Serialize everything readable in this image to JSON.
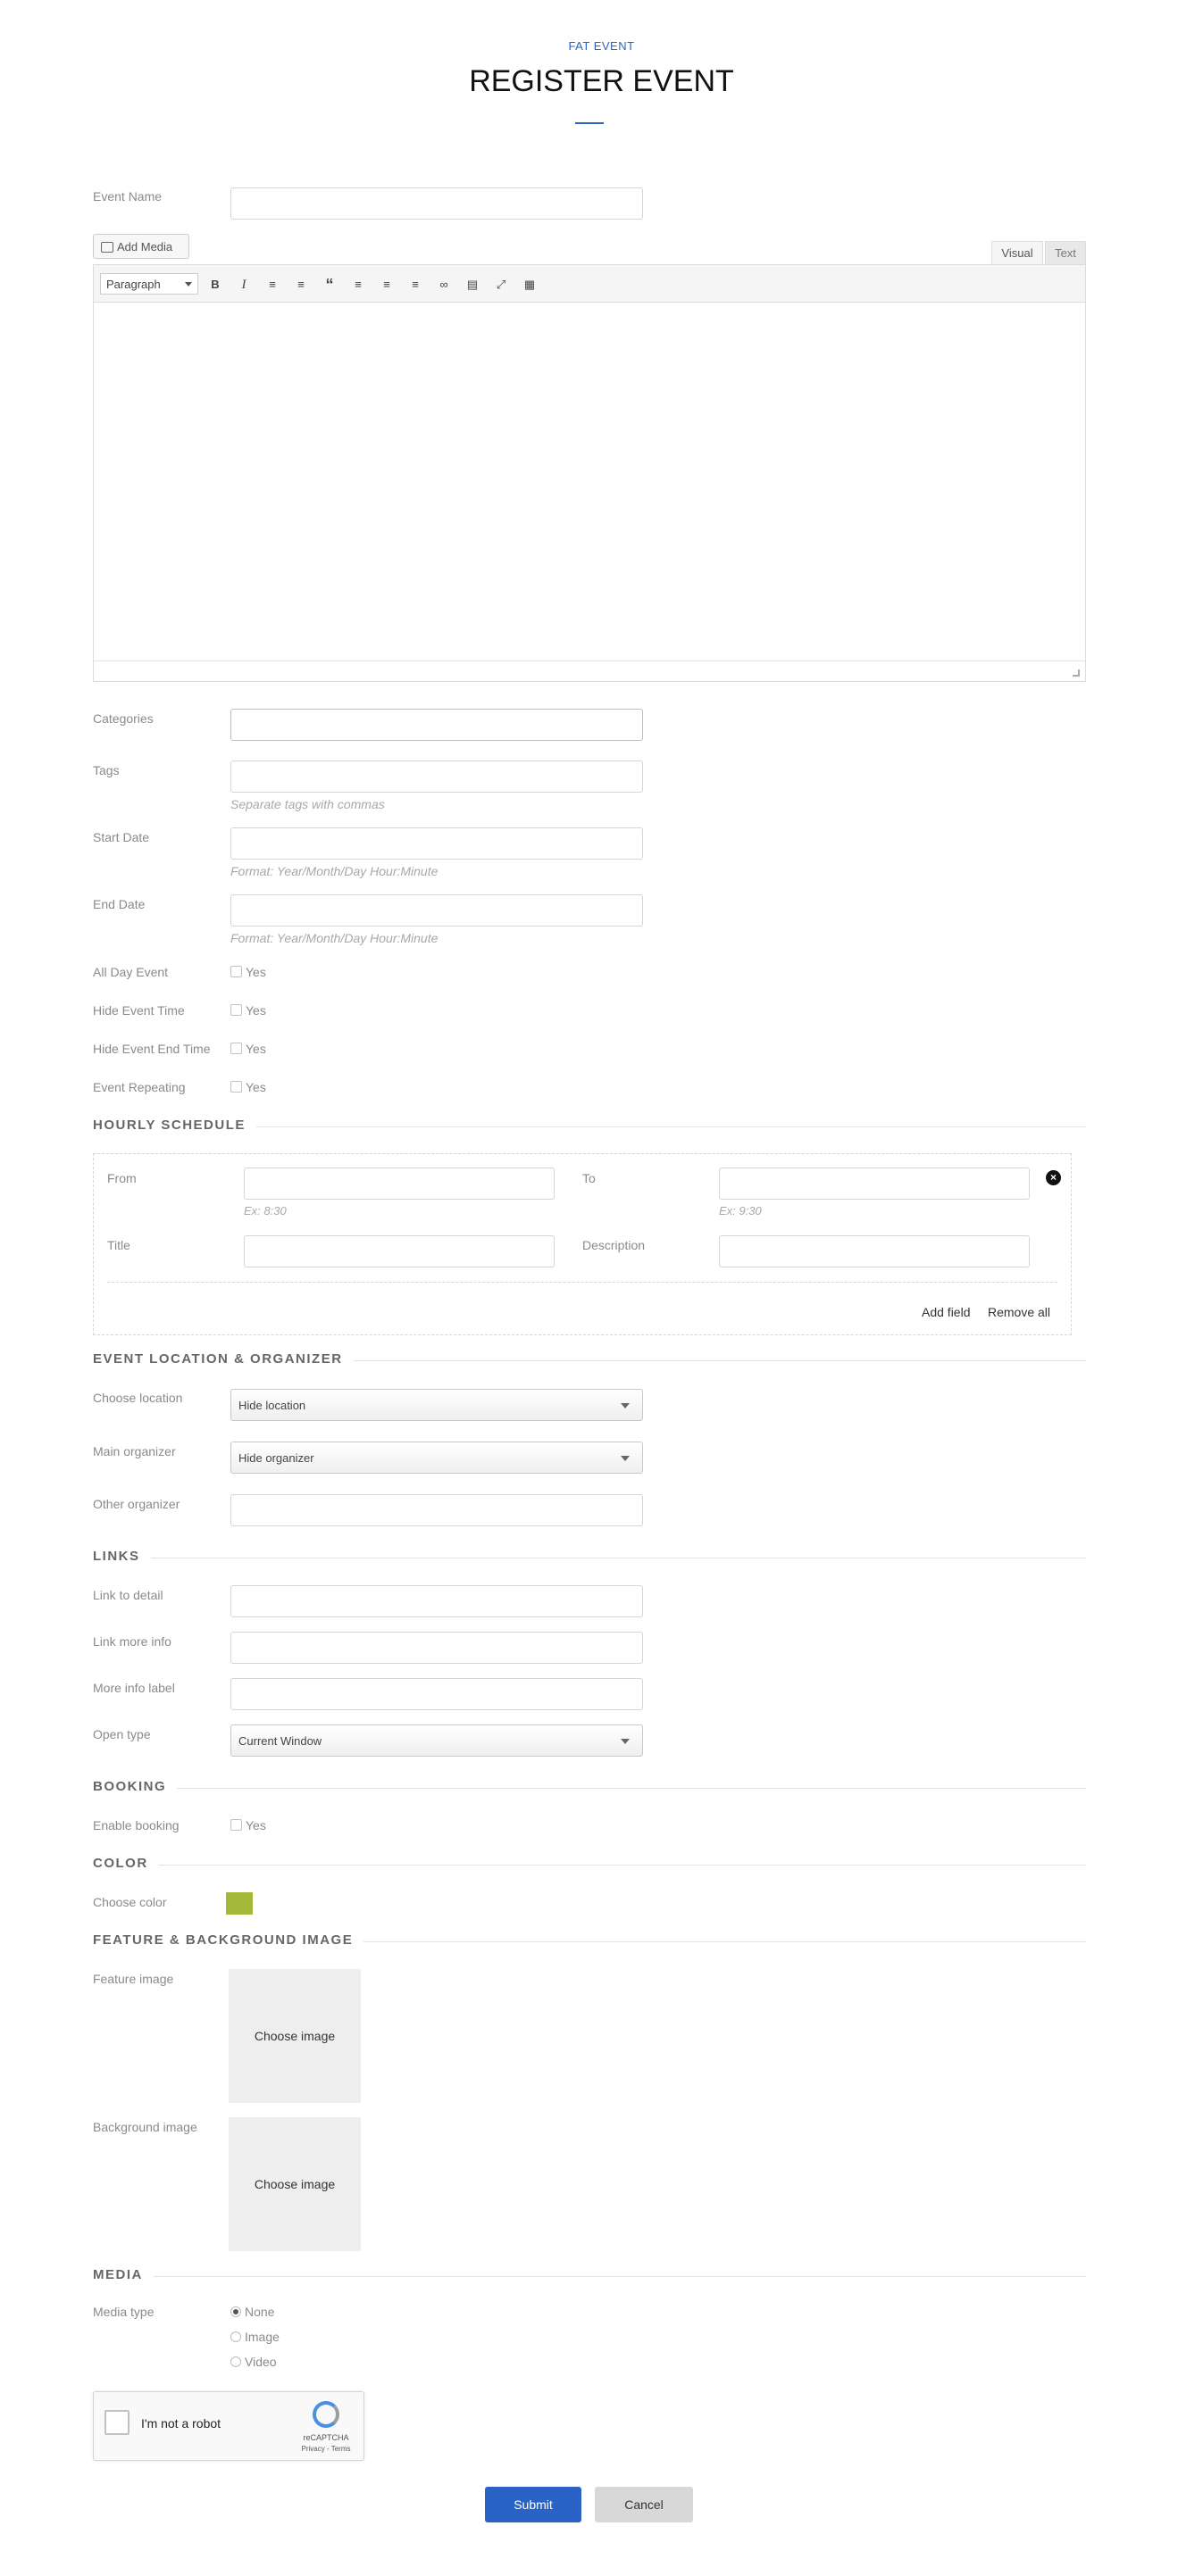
{
  "header": {
    "eyebrow": "FAT EVENT",
    "title": "REGISTER EVENT",
    "accent_color": "#2a63c5"
  },
  "event_name": {
    "label": "Event Name",
    "value": ""
  },
  "editor": {
    "add_media_label": "Add Media",
    "tab_visual": "Visual",
    "tab_text": "Text",
    "format_select": "Paragraph",
    "toolbar_icons": [
      "bold-icon",
      "italic-icon",
      "bullet-list-icon",
      "numbered-list-icon",
      "blockquote-icon",
      "align-left-icon",
      "align-center-icon",
      "align-right-icon",
      "link-icon",
      "read-more-icon",
      "fullscreen-icon",
      "toolbar-toggle-icon"
    ],
    "content": ""
  },
  "fields": {
    "categories": {
      "label": "Categories",
      "value": ""
    },
    "tags": {
      "label": "Tags",
      "value": "",
      "hint": "Separate tags with commas"
    },
    "start_date": {
      "label": "Start Date",
      "value": "",
      "hint": "Format: Year/Month/Day Hour:Minute"
    },
    "end_date": {
      "label": "End Date",
      "value": "",
      "hint": "Format: Year/Month/Day Hour:Minute"
    }
  },
  "checkboxes": {
    "all_day": {
      "label": "All Day Event",
      "option": "Yes",
      "checked": false
    },
    "hide_time": {
      "label": "Hide Event Time",
      "option": "Yes",
      "checked": false
    },
    "hide_end_time": {
      "label": "Hide Event End Time",
      "option": "Yes",
      "checked": false
    },
    "repeating": {
      "label": "Event Repeating",
      "option": "Yes",
      "checked": false
    }
  },
  "hourly_schedule": {
    "title": "HOURLY SCHEDULE",
    "from_label": "From",
    "from_hint": "Ex: 8:30",
    "to_label": "To",
    "to_hint": "Ex: 9:30",
    "title_label": "Title",
    "description_label": "Description",
    "add_field": "Add field",
    "remove_all": "Remove all"
  },
  "location": {
    "title": "EVENT LOCATION & ORGANIZER",
    "choose_location_label": "Choose location",
    "choose_location_value": "Hide location",
    "main_organizer_label": "Main organizer",
    "main_organizer_value": "Hide organizer",
    "other_organizer_label": "Other organizer",
    "other_organizer_value": ""
  },
  "links": {
    "title": "LINKS",
    "link_detail_label": "Link to detail",
    "link_more_label": "Link more info",
    "more_info_label": "More info label",
    "open_type_label": "Open type",
    "open_type_value": "Current Window"
  },
  "booking": {
    "title": "BOOKING",
    "enable_label": "Enable booking",
    "option": "Yes",
    "checked": false
  },
  "color": {
    "title": "COLOR",
    "choose_label": "Choose color",
    "swatch": "#a4b83a"
  },
  "images": {
    "title": "FEATURE & BACKGROUND IMAGE",
    "feature_label": "Feature image",
    "background_label": "Background image",
    "choose_text": "Choose image"
  },
  "media": {
    "title": "MEDIA",
    "type_label": "Media type",
    "options": [
      "None",
      "Image",
      "Video"
    ],
    "selected": "None"
  },
  "captcha": {
    "label": "I'm not a robot",
    "brand": "reCAPTCHA",
    "links": "Privacy - Terms"
  },
  "actions": {
    "submit": "Submit",
    "cancel": "Cancel",
    "submit_color": "#2a63c5"
  }
}
